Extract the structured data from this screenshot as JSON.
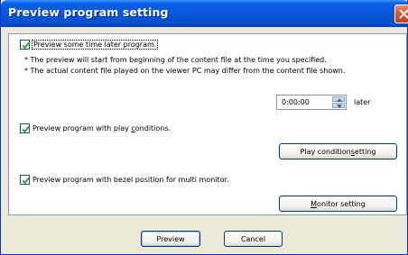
{
  "window": {
    "title": "Preview program setting"
  },
  "option1": {
    "label": "Preview some time later program.",
    "checked": true,
    "note1": "* The preview will start from beginning of the content file at the time you specified.",
    "note2": "* The actual content file played on the viewer PC may differ from the content file shown.",
    "time_value": "0:00:00",
    "later_label": "later"
  },
  "option2": {
    "label_prefix": "Preview program with play ",
    "label_mnemonic": "c",
    "label_suffix": "onditions.",
    "checked": true,
    "button_prefix": "Play condition ",
    "button_mnemonic": "s",
    "button_suffix": "etting"
  },
  "option3": {
    "label": "Preview program with bezel position for multi monitor.",
    "checked": true,
    "button_mnemonic": "M",
    "button_suffix": "onitor setting"
  },
  "footer": {
    "preview_label": "Preview",
    "cancel_label": "Cancel"
  },
  "colors": {
    "titlebar": "#0a56d8",
    "dialog_bg": "#ece9d8",
    "panel_border": "#7f9db9",
    "checkmark": "#21a121",
    "close_button": "#d9542d"
  }
}
